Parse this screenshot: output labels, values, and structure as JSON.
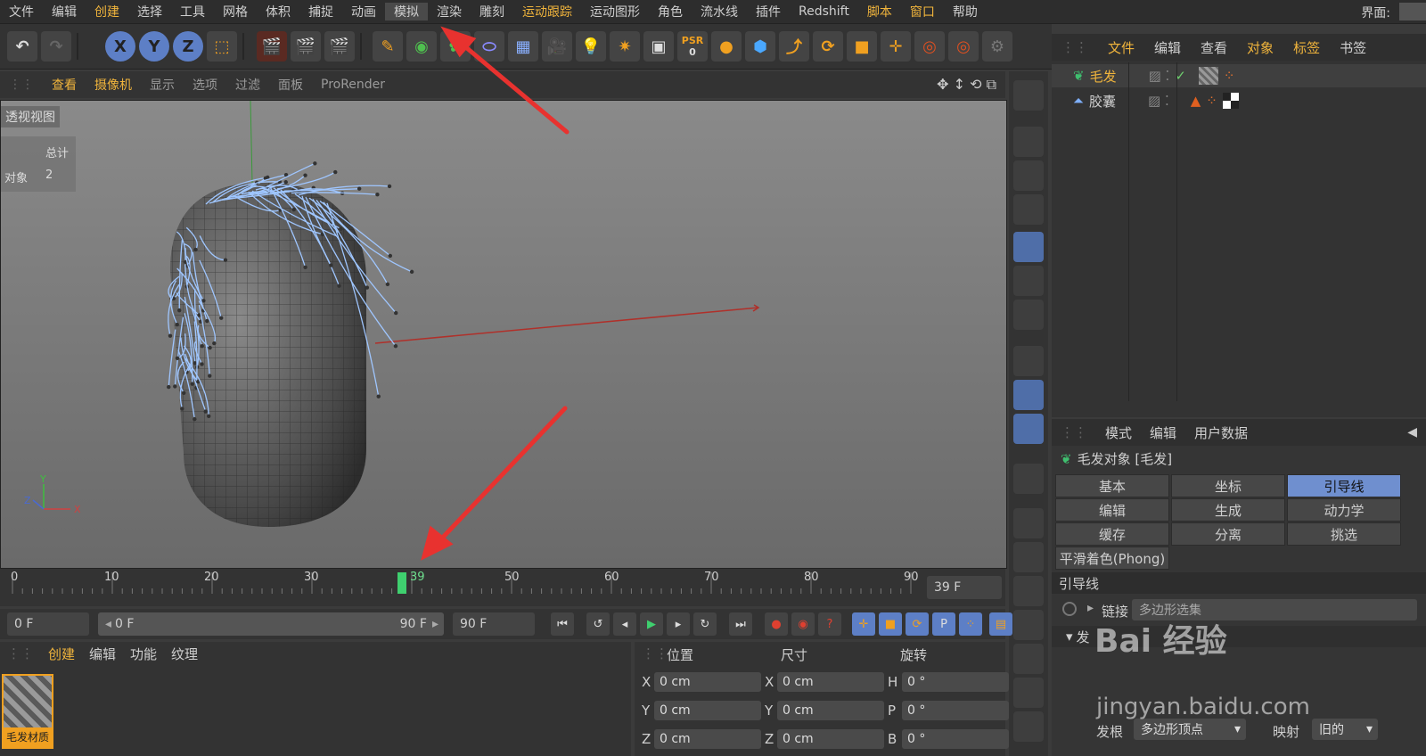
{
  "menubar": {
    "items": [
      {
        "label": "文件"
      },
      {
        "label": "编辑"
      },
      {
        "label": "创建",
        "hl": true
      },
      {
        "label": "选择"
      },
      {
        "label": "工具"
      },
      {
        "label": "网格"
      },
      {
        "label": "体积"
      },
      {
        "label": "捕捉"
      },
      {
        "label": "动画"
      },
      {
        "label": "模拟",
        "active": true
      },
      {
        "label": "渲染"
      },
      {
        "label": "雕刻"
      },
      {
        "label": "运动跟踪",
        "hl": true
      },
      {
        "label": "运动图形"
      },
      {
        "label": "角色"
      },
      {
        "label": "流水线"
      },
      {
        "label": "插件"
      },
      {
        "label": "Redshift"
      },
      {
        "label": "脚本",
        "hl": true
      },
      {
        "label": "窗口",
        "hl": true
      },
      {
        "label": "帮助"
      }
    ],
    "layout_label": "界面:"
  },
  "toolbar": {
    "axis_x": "X",
    "axis_y": "Y",
    "axis_z": "Z",
    "psr_label": "PSR",
    "psr_value": "0"
  },
  "viewport": {
    "menu": [
      {
        "label": "查看",
        "hl": true
      },
      {
        "label": "摄像机",
        "hl": true
      },
      {
        "label": "显示"
      },
      {
        "label": "选项"
      },
      {
        "label": "过滤"
      },
      {
        "label": "面板"
      },
      {
        "label": "ProRender"
      }
    ],
    "view_name": "透视视图",
    "stats_header": "总计",
    "stats_label": "对象",
    "stats_value": "2"
  },
  "object_manager": {
    "menu": [
      {
        "label": "文件",
        "hl": true
      },
      {
        "label": "编辑"
      },
      {
        "label": "查看"
      },
      {
        "label": "对象",
        "hl": true
      },
      {
        "label": "标签",
        "hl": true
      },
      {
        "label": "书签"
      }
    ],
    "objects": [
      {
        "name": "毛发",
        "selected": true
      },
      {
        "name": "胶囊",
        "selected": false
      }
    ]
  },
  "attribute_manager": {
    "menu": [
      "模式",
      "编辑",
      "用户数据"
    ],
    "object_title": "毛发对象 [毛发]",
    "tabs_row1": [
      "基本",
      "坐标",
      "引导线"
    ],
    "tabs_row2": [
      "编辑",
      "生成",
      "动力学"
    ],
    "tabs_row3": [
      "缓存",
      "分离",
      "挑选"
    ],
    "tab_phong": "平滑着色(Phong)",
    "active_tab": "引导线",
    "section_title": "引导线",
    "link_label": "链接",
    "link_value": "多边形选集",
    "hair_root_label": "发根",
    "hair_root_value": "多边形顶点",
    "mapping_label": "映射",
    "mapping_value": "旧的",
    "collapse_label": "发"
  },
  "timeline": {
    "ticks": [
      "0",
      "10",
      "20",
      "30",
      "39",
      "50",
      "60",
      "70",
      "80",
      "90"
    ],
    "current_frame_label": "39",
    "current_frame_field": "39 F",
    "start_field": "0 F",
    "range_start": "0 F",
    "range_end": "90 F",
    "end_field": "90 F"
  },
  "material_manager": {
    "menu": [
      {
        "label": "创建",
        "hl": true
      },
      {
        "label": "编辑"
      },
      {
        "label": "功能"
      },
      {
        "label": "纹理"
      }
    ],
    "materials": [
      "毛发材质"
    ]
  },
  "coordinates": {
    "headers": [
      "位置",
      "尺寸",
      "旋转"
    ],
    "rows": [
      {
        "a": "X",
        "pos": "0 cm",
        "b": "X",
        "size": "0 cm",
        "c": "H",
        "rot": "0 °"
      },
      {
        "a": "Y",
        "pos": "0 cm",
        "b": "Y",
        "size": "0 cm",
        "c": "P",
        "rot": "0 °"
      },
      {
        "a": "Z",
        "pos": "0 cm",
        "b": "Z",
        "size": "0 cm",
        "c": "B",
        "rot": "0 °"
      }
    ]
  },
  "watermark": {
    "text1": "Bai 经验",
    "text2": "jingyan.baidu.com"
  },
  "colors": {
    "accent": "#f0b43c",
    "selected_tab": "#6f8fcf",
    "annotation": "#e8322f",
    "hair": "#9fc6ff"
  }
}
